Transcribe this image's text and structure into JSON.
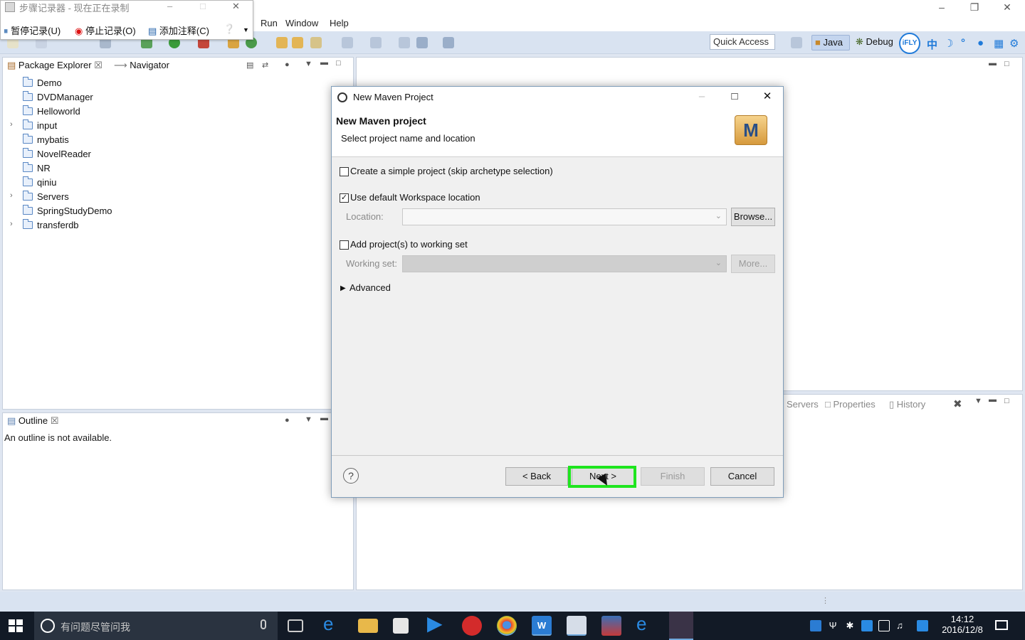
{
  "eclipse": {
    "menu": [
      "Run",
      "Window",
      "Help"
    ],
    "quick_access": "Quick Access",
    "perspectives": {
      "java": "Java",
      "debug": "Debug"
    },
    "ime": {
      "ifly_label": "iFLY",
      "zh": "中"
    }
  },
  "steps_recorder": {
    "title": "步骤记录器 - 现在正在录制",
    "pause_button": "暂停记录(U)",
    "stop_button": "停止记录(O)",
    "comment_button": "添加注释(C)"
  },
  "package_explorer": {
    "tab_label": "Package Explorer",
    "navigator_tab": "Navigator",
    "items": [
      {
        "label": "Demo",
        "expandable": false
      },
      {
        "label": "DVDManager",
        "expandable": false
      },
      {
        "label": "Helloworld",
        "expandable": false
      },
      {
        "label": "input",
        "expandable": true
      },
      {
        "label": "mybatis",
        "expandable": false
      },
      {
        "label": "NovelReader",
        "expandable": false
      },
      {
        "label": "NR",
        "expandable": false
      },
      {
        "label": "qiniu",
        "expandable": false
      },
      {
        "label": "Servers",
        "expandable": true
      },
      {
        "label": "SpringStudyDemo",
        "expandable": false
      },
      {
        "label": "transferdb",
        "expandable": true
      }
    ]
  },
  "outline": {
    "tab_label": "Outline",
    "message": "An outline is not available."
  },
  "bottom_tabs": {
    "servers": "Servers",
    "properties": "Properties",
    "history": "History"
  },
  "dialog": {
    "window_title": "New Maven Project",
    "heading": "New Maven project",
    "subheading": "Select project name and location",
    "logo_letter": "M",
    "simple_project": {
      "label": "Create a simple project (skip archetype selection)",
      "checked": false
    },
    "default_workspace": {
      "label": "Use default Workspace location",
      "checked": true
    },
    "location_label": "Location:",
    "browse_button": "Browse...",
    "working_set_checkbox": {
      "label": "Add project(s) to working set",
      "checked": false
    },
    "working_set_label": "Working set:",
    "more_button": "More...",
    "advanced_label": "Advanced",
    "back_button": "< Back",
    "next_button": "Next >",
    "finish_button": "Finish",
    "cancel_button": "Cancel"
  },
  "taskbar": {
    "search_placeholder": "有问题尽管问我",
    "time": "14:12",
    "date": "2016/12/8"
  },
  "colors": {
    "highlight": "#1ee51e",
    "accent": "#1f7ad9",
    "toolbar_bg": "#d9e3f1",
    "taskbar_bg": "#121a26"
  }
}
